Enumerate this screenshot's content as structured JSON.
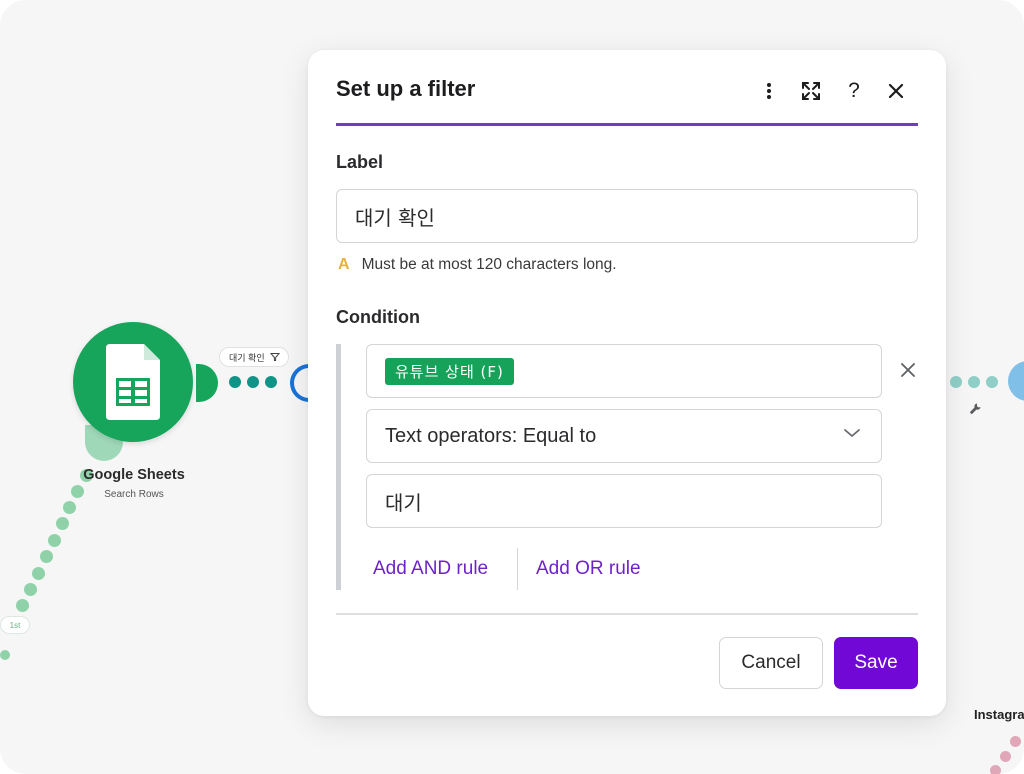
{
  "canvas": {
    "node": {
      "title": "Google Sheets",
      "subtitle": "Search Rows"
    },
    "filter_chip_label": "대기 확인",
    "route_badge": "1st",
    "right_node_label": "Instagra"
  },
  "dialog": {
    "title": "Set up a filter",
    "header_icons": [
      "more-vertical-icon",
      "expand-icon",
      "help-icon",
      "close-icon"
    ],
    "label_heading": "Label",
    "label_value": "대기 확인",
    "label_hint": "Must be at most 120 characters long.",
    "condition_heading": "Condition",
    "condition": {
      "field_chip": "유튜브 상태 (F)",
      "operator": "Text operators: Equal to",
      "value": "대기"
    },
    "add_and_rule": "Add AND rule",
    "add_or_rule": "Add OR rule",
    "cancel_label": "Cancel",
    "save_label": "Save"
  },
  "colors": {
    "accent": "#7108d6",
    "title_rule": "#6d3fb9",
    "sheets_green": "#17a55b",
    "chip_green": "#16a359",
    "link_purple": "#6e22c9",
    "warning": "#e2b43b"
  }
}
